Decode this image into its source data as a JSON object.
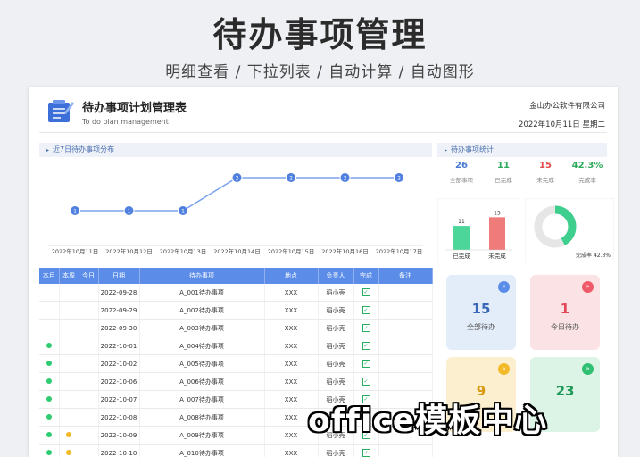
{
  "banner": {
    "title": "待办事项管理",
    "subtitle": "明细查看 / 下拉列表 / 自动计算 / 自动图形"
  },
  "header": {
    "title": "待办事项计划管理表",
    "subtitle": "To do plan management",
    "company": "金山办公软件有限公司",
    "date": "2022年10月11日  星期二",
    "logo_icon": "notepad-pen-icon"
  },
  "trend_section": {
    "title": "近7日待办事项分布"
  },
  "stats_section": {
    "title": "待办事项统计"
  },
  "chart_data": [
    {
      "type": "line",
      "x": [
        "2022年10月11日",
        "2022年10月12日",
        "2022年10月13日",
        "2022年10月14日",
        "2022年10月15日",
        "2022年10月16日",
        "2022年10月17日"
      ],
      "y": [
        1,
        1,
        1,
        2,
        2,
        2,
        2
      ],
      "color": "#4f80e0"
    },
    {
      "type": "bar",
      "categories": [
        "已完成",
        "未完成"
      ],
      "values": [
        11,
        15
      ],
      "colors": [
        "#4dd69a",
        "#f07b7b"
      ]
    },
    {
      "type": "pie",
      "labels": [
        "完成率"
      ],
      "values": [
        42.3
      ],
      "caption": "完成率 42.3%",
      "colors": [
        "#3ecf8e",
        "#e6e6e6"
      ]
    }
  ],
  "stats": [
    {
      "value": "26",
      "label": "全部事项",
      "color": "#4a7bd0"
    },
    {
      "value": "11",
      "label": "已完成",
      "color": "#2eaa5c"
    },
    {
      "value": "15",
      "label": "未完成",
      "color": "#e04848"
    },
    {
      "value": "42.3%",
      "label": "完成率",
      "color": "#2eaa5c"
    }
  ],
  "cards": [
    {
      "value": "15",
      "label": "全部待办",
      "icon": "double-left-chevron-icon",
      "bg": "#e3ecf9",
      "accent": "#5b8de8",
      "numColor": "#3a66b8"
    },
    {
      "value": "1",
      "label": "今日待办",
      "icon": "double-right-chevron-icon",
      "bg": "#fbe3e5",
      "accent": "#ee5a6a",
      "numColor": "#e04858"
    },
    {
      "value": "9",
      "label": "",
      "icon": "double-right-chevron-icon",
      "bg": "#fcefcf",
      "accent": "#f2b928",
      "numColor": "#d99a10"
    },
    {
      "value": "23",
      "label": "",
      "icon": "double-right-chevron-icon",
      "bg": "#dcf4e6",
      "accent": "#2fbf71",
      "numColor": "#1f9a58"
    }
  ],
  "table": {
    "columns": [
      "本月",
      "本周",
      "今日",
      "日期",
      "待办事项",
      "地点",
      "负责人",
      "完成",
      "备注"
    ],
    "rows": [
      {
        "month": "",
        "week": "",
        "today": "",
        "date": "2022-09-28",
        "task": "A_001待办事项",
        "place": "XXX",
        "owner": "稻小壳",
        "done": true,
        "note": ""
      },
      {
        "month": "",
        "week": "",
        "today": "",
        "date": "2022-09-29",
        "task": "A_002待办事项",
        "place": "XXX",
        "owner": "稻小壳",
        "done": true,
        "note": ""
      },
      {
        "month": "",
        "week": "",
        "today": "",
        "date": "2022-09-30",
        "task": "A_003待办事项",
        "place": "XXX",
        "owner": "稻小壳",
        "done": true,
        "note": ""
      },
      {
        "month": "green",
        "week": "",
        "today": "",
        "date": "2022-10-01",
        "task": "A_004待办事项",
        "place": "XXX",
        "owner": "稻小壳",
        "done": true,
        "note": ""
      },
      {
        "month": "green",
        "week": "",
        "today": "",
        "date": "2022-10-02",
        "task": "A_005待办事项",
        "place": "XXX",
        "owner": "稻小壳",
        "done": true,
        "note": ""
      },
      {
        "month": "green",
        "week": "",
        "today": "",
        "date": "2022-10-06",
        "task": "A_006待办事项",
        "place": "XXX",
        "owner": "稻小壳",
        "done": true,
        "note": ""
      },
      {
        "month": "green",
        "week": "",
        "today": "",
        "date": "2022-10-07",
        "task": "A_007待办事项",
        "place": "XXX",
        "owner": "稻小壳",
        "done": true,
        "note": ""
      },
      {
        "month": "green",
        "week": "",
        "today": "",
        "date": "2022-10-08",
        "task": "A_008待办事项",
        "place": "XXX",
        "owner": "稻小壳",
        "done": true,
        "note": ""
      },
      {
        "month": "green",
        "week": "yellow",
        "today": "",
        "date": "2022-10-09",
        "task": "A_009待办事项",
        "place": "XXX",
        "owner": "稻小壳",
        "done": true,
        "note": ""
      },
      {
        "month": "green",
        "week": "yellow",
        "today": "",
        "date": "2022-10-10",
        "task": "A_010待办事项",
        "place": "XXX",
        "owner": "稻小壳",
        "done": true,
        "note": ""
      }
    ]
  },
  "watermark": "office模板中心"
}
